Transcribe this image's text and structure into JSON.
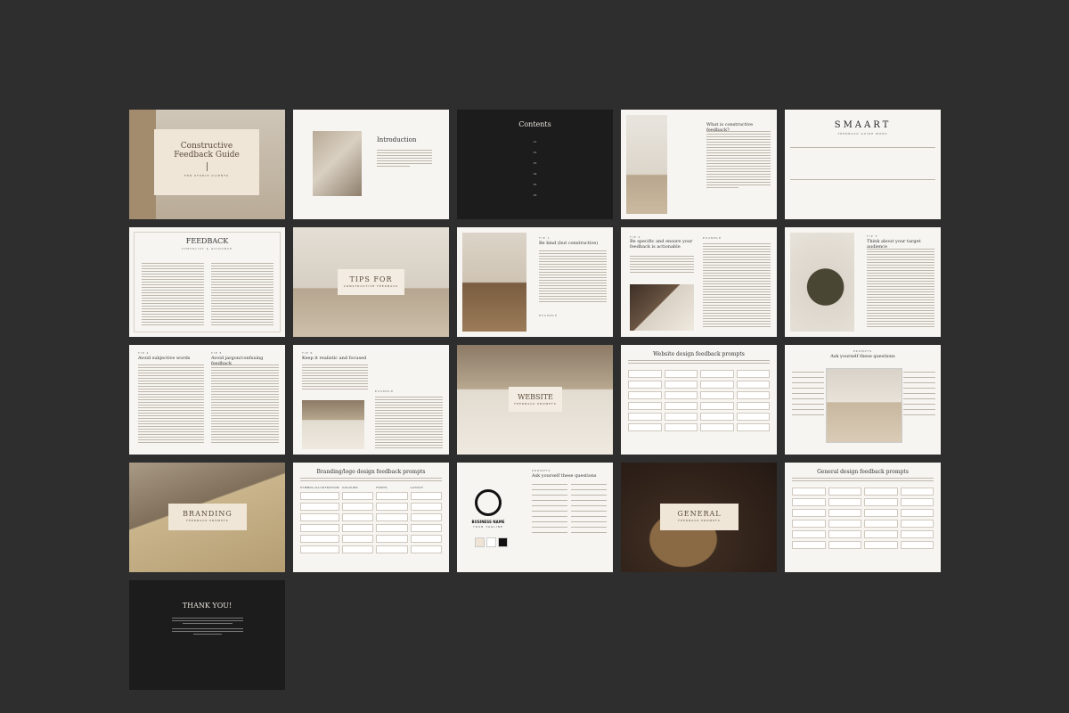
{
  "slides": {
    "cover": {
      "title": "Constructive Feedback Guide",
      "subtitle": "FOR STUDIO CLIENTS"
    },
    "intro": {
      "title": "Introduction"
    },
    "contents": {
      "title": "Contents",
      "items": [
        "01",
        "02",
        "03",
        "04",
        "05",
        "06"
      ]
    },
    "what_is": {
      "title": "What is constructive feedback?"
    },
    "smaart": {
      "title": "SMAART",
      "subtitle": "FEEDBACK GUIDE WORK"
    },
    "feedback_check": {
      "title": "FEEDBACK",
      "subtitle": "CHECKLIST & GUIDANCE"
    },
    "tips_for": {
      "title": "TIPS FOR",
      "subtitle": "CONSTRUCTIVE FEEDBACK"
    },
    "tip1": {
      "label": "TIP 1",
      "title": "Be kind (but constructive)"
    },
    "tip2": {
      "label": "TIP 2",
      "title": "Be specific and ensure your feedback is actionable"
    },
    "example": {
      "label": "EXAMPLE"
    },
    "tip3": {
      "label": "TIP 3",
      "title": "Think about your target audience"
    },
    "tip4": {
      "label": "TIP 4",
      "title": "Avoid subjective words"
    },
    "tip5": {
      "label": "TIP 5",
      "title": "Avoid jargon/confusing feedback"
    },
    "tip6": {
      "label": "TIP 6",
      "title": "Keep it realistic and focused"
    },
    "website": {
      "title": "WEBSITE",
      "subtitle": "FEEDBACK PROMPTS"
    },
    "website_prompts": {
      "title": "Website design feedback prompts"
    },
    "prompts_ask": {
      "label": "PROMPTS",
      "title": "Ask yourself these questions"
    },
    "branding": {
      "title": "BRANDING",
      "subtitle": "FEEDBACK PROMPTS"
    },
    "branding_prompts": {
      "title": "Branding/logo design feedback prompts",
      "cols": [
        "SYMBOL/ILLUSTRATION",
        "COLOURS",
        "FONTS",
        "LAYOUT"
      ]
    },
    "business": {
      "name": "BUSINESS NAME",
      "tagline": "YOUR TAGLINE",
      "prompts_label": "PROMPTS",
      "prompts_title": "Ask yourself these questions"
    },
    "general": {
      "title": "GENERAL",
      "subtitle": "FEEDBACK PROMPTS"
    },
    "general_prompts": {
      "title": "General design feedback prompts"
    },
    "thanks": {
      "title": "THANK YOU!"
    }
  }
}
